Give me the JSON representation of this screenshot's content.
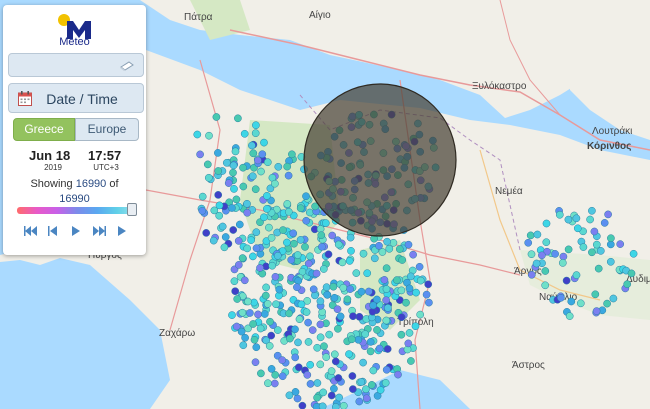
{
  "logo": {
    "text": "Meteo"
  },
  "search": {
    "icon": "search-icon",
    "value": ""
  },
  "date_button": {
    "label": "Date / Time",
    "icon": "calendar-icon"
  },
  "region_tabs": [
    {
      "label": "Greece",
      "active": true
    },
    {
      "label": "Europe",
      "active": false
    }
  ],
  "datetime": {
    "day": "Jun 18",
    "year": "2019",
    "time": "17:57",
    "tz": "UTC+3"
  },
  "status": {
    "prefix": "Showing",
    "shown": "16990",
    "of": "of",
    "total": "16990"
  },
  "playback": {
    "slider_position": 1.0,
    "buttons": [
      "rewind-icon",
      "step-back-icon",
      "play-icon",
      "fast-forward-icon",
      "step-forward-icon"
    ]
  },
  "map_labels": [
    "Πάτρα",
    "Αίγιο",
    "Ξυλόκαστρο",
    "Λουτράκι",
    "Κόρινθος",
    "Νεμέα",
    "Πύργος",
    "Άργος",
    "Ναύπλιο",
    "Ζαχάρω",
    "Τρίπολη",
    "Άστρος",
    "Δυδιμα"
  ],
  "colors": {
    "accent_green": "#93c25e",
    "panel_button": "#dde8f2",
    "logo_blue": "#1a2a8a",
    "logo_yellow": "#f2c200"
  }
}
